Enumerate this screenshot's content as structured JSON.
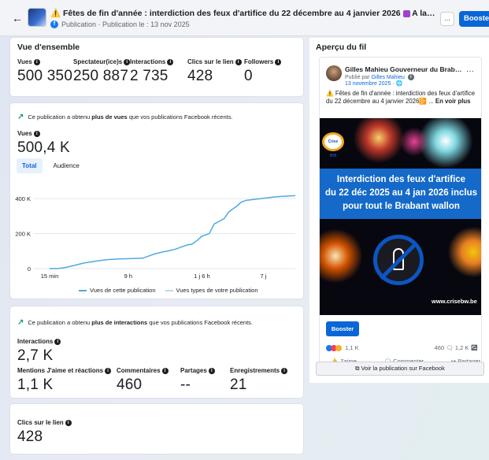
{
  "header": {
    "title_warning_icon": "⚠️",
    "title": "Fêtes de fin d'année : interdiction des feux d'artifice du 22 décembre au 4 janvier 2026",
    "title_suffix": "A la demande de communes, des serv...",
    "subtitle": "Publication · Publication le : 13 nov 2025",
    "more_label": "...",
    "boost_label": "Booster"
  },
  "overview": {
    "title": "Vue d'ensemble",
    "metrics": [
      {
        "label": "Vues",
        "value": "500 350"
      },
      {
        "label": "Spectateur(ice)s",
        "value": "250 887"
      },
      {
        "label": "Interactions",
        "value": "2 735"
      },
      {
        "label": "Clics sur le lien",
        "value": "428"
      },
      {
        "label": "Followers",
        "value": "0"
      }
    ]
  },
  "views_card": {
    "insight_prefix": "Ce publication a obtenu ",
    "insight_bold": "plus de vues",
    "insight_suffix": " que vos publications Facebook récents.",
    "metric_label": "Vues",
    "metric_value": "500,4 K",
    "tab_total": "Total",
    "tab_audience": "Audience",
    "legend_series1": "Vues de cette publication",
    "legend_series2": "Vues types de votre publication"
  },
  "chart_data": {
    "type": "line",
    "x_ticks": [
      "15 min",
      "9 h",
      "1 j 6 h",
      "7 j"
    ],
    "y_ticks": [
      "0",
      "200 K",
      "400 K"
    ],
    "ylim": [
      0,
      450000
    ],
    "grid": true,
    "legend_placement": "bottom",
    "series": [
      {
        "name": "Vues de cette publication",
        "color": "#4fa9e3",
        "x": [
          0,
          3,
          6,
          10,
          14,
          20,
          24,
          28,
          31,
          35,
          38,
          41,
          43,
          46,
          48,
          51,
          53,
          56,
          58,
          60,
          62,
          65,
          67,
          69,
          71,
          73,
          76,
          78,
          80,
          83,
          86,
          89,
          92,
          95,
          98,
          100
        ],
        "values": [
          0,
          0,
          5000,
          18000,
          32000,
          45000,
          52000,
          55000,
          56000,
          58000,
          60000,
          75000,
          85000,
          95000,
          100000,
          110000,
          120000,
          135000,
          140000,
          160000,
          185000,
          200000,
          255000,
          270000,
          285000,
          325000,
          355000,
          380000,
          390000,
          395000,
          400000,
          405000,
          410000,
          413000,
          415000,
          417000
        ]
      },
      {
        "name": "Vues types de votre publication",
        "color": "#b9d9f2",
        "x": [],
        "values": []
      }
    ]
  },
  "interactions_card": {
    "insight_prefix": "Ce publication a obtenu ",
    "insight_bold": "plus de interactions",
    "insight_suffix": " que vos publications Facebook récents.",
    "metric_label": "Interactions",
    "metric_value": "2,7 K",
    "sub_metrics": [
      {
        "label": "Mentions J'aime et réactions",
        "value": "1,1 K"
      },
      {
        "label": "Commentaires",
        "value": "460"
      },
      {
        "label": "Partages",
        "value": "--"
      },
      {
        "label": "Enregistrements",
        "value": "21"
      }
    ]
  },
  "clicks_card": {
    "label": "Clics sur le lien",
    "value": "428"
  },
  "preview": {
    "title": "Aperçu du fil",
    "page_name": "Gilles Mahieu Gouverneur du Brabant ...",
    "published_by_prefix": "Publié par ",
    "published_by_name": "Gilles Mahieu",
    "date": "13 novembre 2025 · 🌐",
    "text": "⚠️ Fêtes de fin d'année : interdiction des feux d'artifice du 22 décembre au 4 janvier 2026📴 ... ",
    "see_more": "En voir plus",
    "logo_text": "Crise BW",
    "banner_line1": "Interdiction des feux d'artifice",
    "banner_line2": "du 22 déc 2025 au 4 jan 2026 inclus",
    "banner_line3": "pour tout le Brabant wallon",
    "site": "www.crisebw.be",
    "boost_label": "Booster",
    "reactions_count": "1,1 K",
    "comments_count": "460",
    "shares_count": "1,2 K",
    "action_like": "J'aime",
    "action_comment": "Commenter",
    "action_share": "Partager",
    "view_on_fb": "Voir la publication sur Facebook"
  }
}
